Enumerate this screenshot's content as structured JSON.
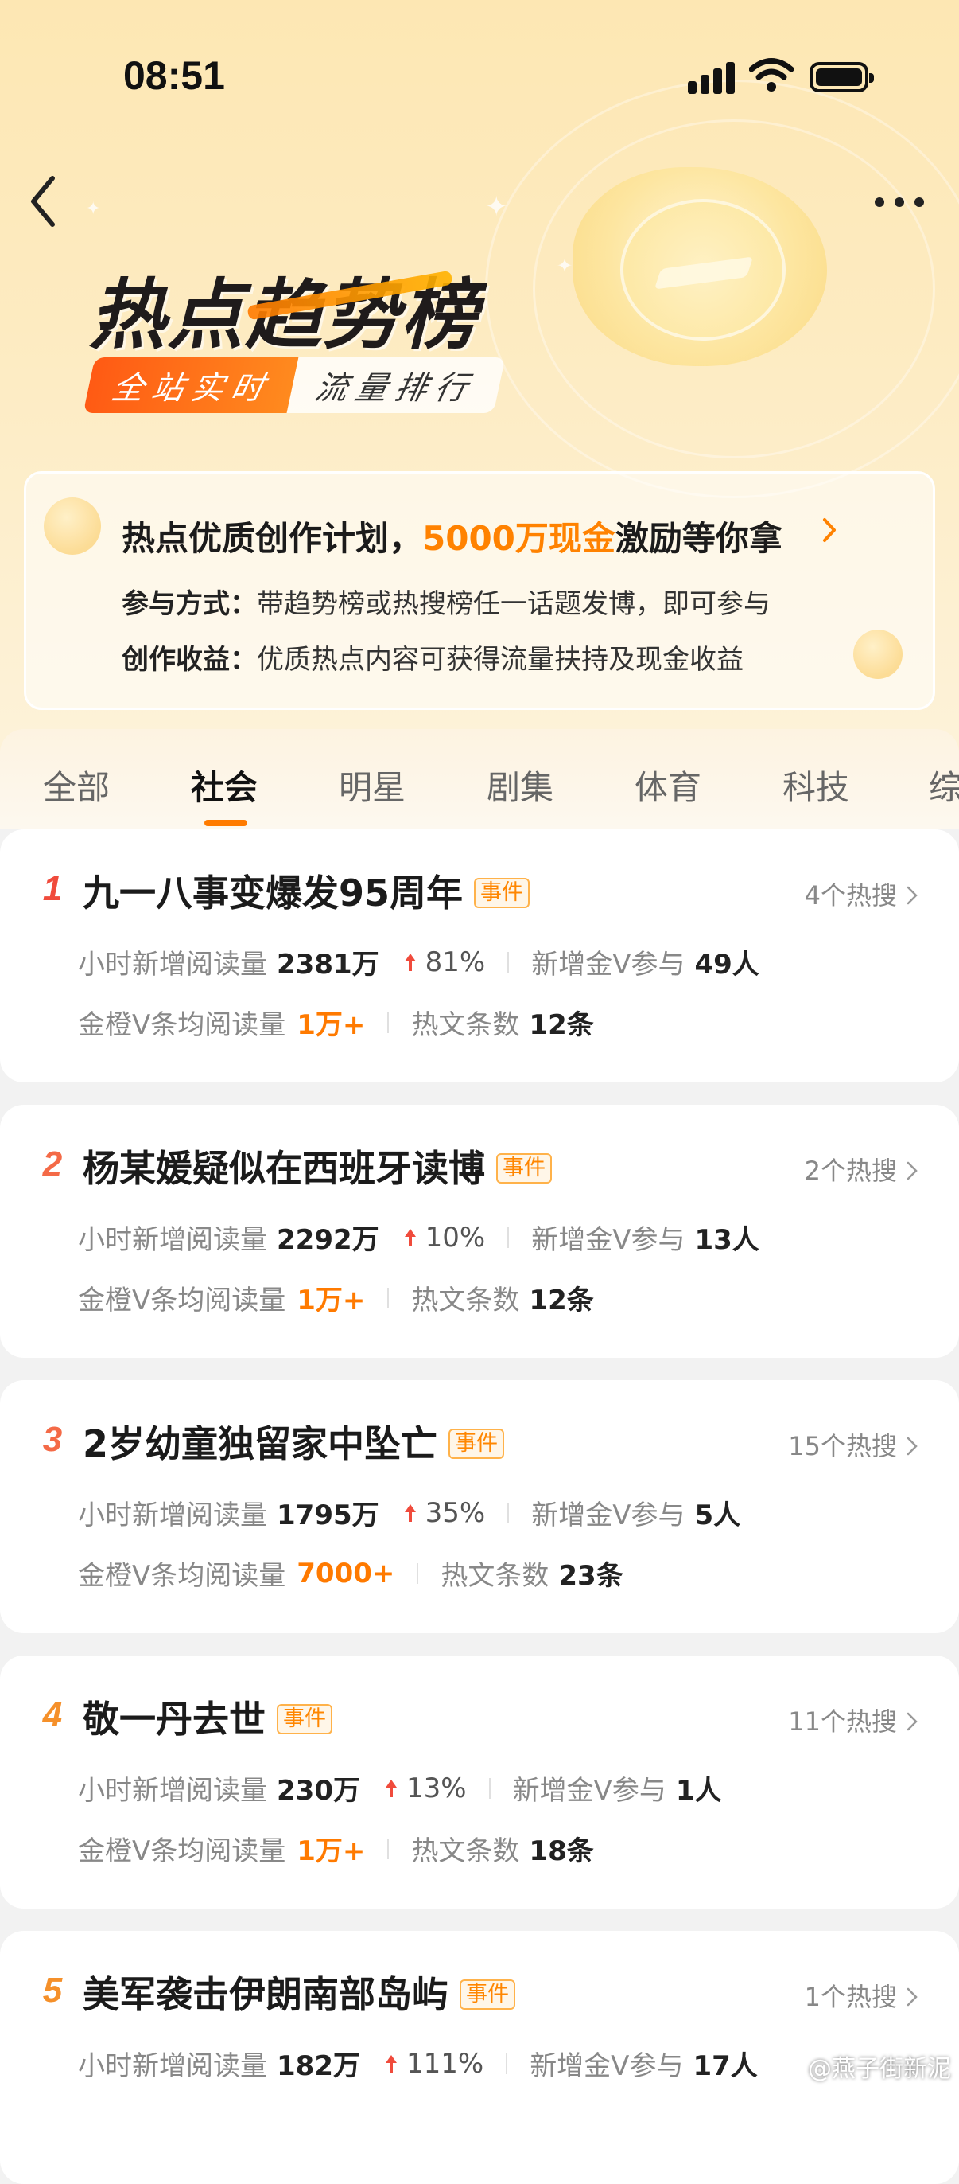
{
  "status_bar": {
    "time": "08:51"
  },
  "header": {
    "title": "热点趋势榜",
    "tagline_a": "全站实时",
    "tagline_b": "流量排行"
  },
  "promo": {
    "title_prefix": "热点优质创作计划，",
    "title_highlight": "5000万现金",
    "title_suffix": "激励等你拿",
    "line1_label": "参与方式：",
    "line1_text": "带趋势榜或热搜榜任一话题发博，即可参与",
    "line2_label": "创作收益：",
    "line2_text": "优质热点内容可获得流量扶持及现金收益"
  },
  "tabs": [
    {
      "label": "全部"
    },
    {
      "label": "社会",
      "active": true
    },
    {
      "label": "明星"
    },
    {
      "label": "剧集"
    },
    {
      "label": "体育"
    },
    {
      "label": "科技"
    },
    {
      "label": "综"
    }
  ],
  "labels": {
    "hourly_reads": "小时新增阅读量",
    "new_gold_v": "新增金V参与",
    "avg_reads": "金橙V条均阅读量",
    "hot_posts": "热文条数"
  },
  "items": [
    {
      "rank": "1",
      "rank_color": "#f04b3c",
      "title": "九一八事变爆发95周年",
      "badge": "事件",
      "hot_count": "4个热搜",
      "reads": "2381万",
      "growth": "81%",
      "gold_v": "49人",
      "avg_reads": "1万+",
      "posts": "12条"
    },
    {
      "rank": "2",
      "rank_color": "#f46a47",
      "title": "杨某媛疑似在西班牙读博",
      "badge": "事件",
      "hot_count": "2个热搜",
      "reads": "2292万",
      "growth": "10%",
      "gold_v": "13人",
      "avg_reads": "1万+",
      "posts": "12条"
    },
    {
      "rank": "3",
      "rank_color": "#f46a47",
      "title": "2岁幼童独留家中坠亡",
      "badge": "事件",
      "hot_count": "15个热搜",
      "reads": "1795万",
      "growth": "35%",
      "gold_v": "5人",
      "avg_reads": "7000+",
      "posts": "23条"
    },
    {
      "rank": "4",
      "rank_color": "#f5902a",
      "title": "敬一丹去世",
      "badge": "事件",
      "hot_count": "11个热搜",
      "reads": "230万",
      "growth": "13%",
      "gold_v": "1人",
      "avg_reads": "1万+",
      "posts": "18条"
    },
    {
      "rank": "5",
      "rank_color": "#f5902a",
      "title": "美军袭击伊朗南部岛屿",
      "badge": "事件",
      "hot_count": "1个热搜",
      "reads": "182万",
      "growth": "111%",
      "gold_v": "17人",
      "avg_reads": "",
      "posts": ""
    }
  ],
  "watermark": "@燕子街新泥",
  "colors": {
    "accent": "#ff7b00",
    "up_arrow": "#f04b3c"
  }
}
